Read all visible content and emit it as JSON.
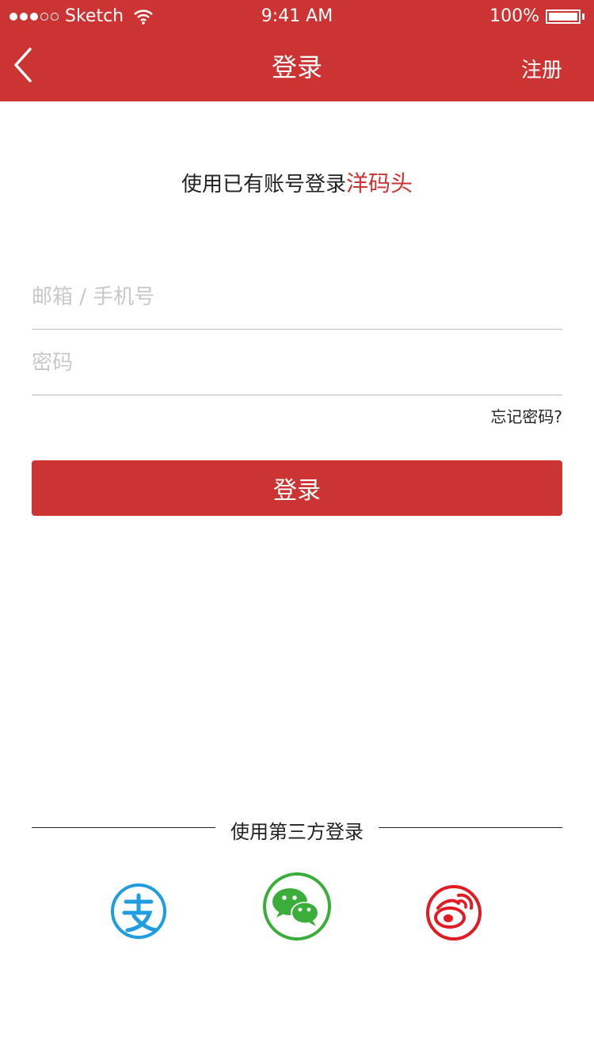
{
  "status_bar": {
    "carrier": "Sketch",
    "time": "9:41 AM",
    "battery": "100%"
  },
  "nav": {
    "title": "登录",
    "right_label": "注册",
    "back_icon": "chevron-left-icon"
  },
  "intro": {
    "text": "使用已有账号登录",
    "brand": "洋码头"
  },
  "form": {
    "account_placeholder": "邮箱 / 手机号",
    "password_placeholder": "密码",
    "forgot_label": "忘记密码?",
    "login_button": "登录"
  },
  "third_party": {
    "label": "使用第三方登录",
    "providers": [
      {
        "name": "alipay",
        "icon": "alipay-icon",
        "color": "#1f9de0"
      },
      {
        "name": "wechat",
        "icon": "wechat-icon",
        "color": "#3aad3a"
      },
      {
        "name": "weibo",
        "icon": "weibo-icon",
        "color": "#e21a22"
      }
    ]
  },
  "colors": {
    "accent": "#cc3333"
  }
}
